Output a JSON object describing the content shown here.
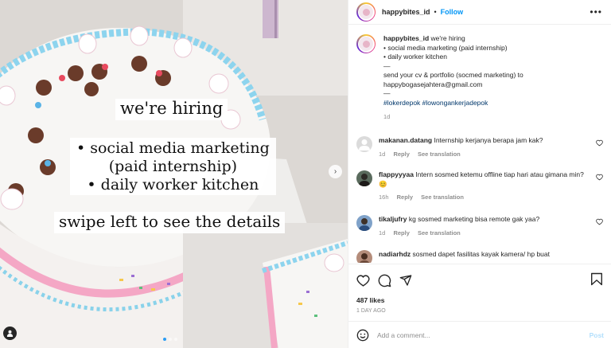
{
  "post": {
    "media_captions": {
      "line1": "we're hiring",
      "line2a": "• social media marketing",
      "line2b": "(paid internship)",
      "line2c": "• daily worker kitchen",
      "line3": "swipe left to see the details"
    },
    "carousel": {
      "total": 3,
      "active": 1
    }
  },
  "header": {
    "username": "happybites_id",
    "separator": "•",
    "follow_label": "Follow",
    "more_icon": "more-horizontal-icon"
  },
  "caption": {
    "username": "happybites_id",
    "first_line": "we're hiring",
    "lines": [
      "• social media marketing (paid internship)",
      "• daily worker kitchen",
      "—",
      "send your cv & portfolio (socmed marketing) to",
      "happybogasejahtera@gmail.com",
      "—"
    ],
    "tags": "#lokerdepok #lowongankerjadepok",
    "age": "1d"
  },
  "comments": [
    {
      "username": "makanan.datang",
      "text": "Internship kerjanya berapa jam kak?",
      "age": "1d",
      "reply": "Reply",
      "translate": "See translation"
    },
    {
      "username": "flappyyyaa",
      "text": "Intern sosmed ketemu offline tiap hari atau gimana min? 😊",
      "age": "16h",
      "reply": "Reply",
      "translate": "See translation"
    },
    {
      "username": "tikaljufry",
      "text": "kg sosmed marketing bisa remote gak yaa?",
      "age": "1d",
      "reply": "Reply",
      "translate": "See translation"
    },
    {
      "username": "nadiarhdz",
      "text": "sosmed dapet fasilitas kayak kamera/ hp buat",
      "age": "",
      "reply": "",
      "translate": ""
    }
  ],
  "actions": {
    "likes": "487 likes",
    "time": "1 day ago"
  },
  "add_comment": {
    "placeholder": "Add a comment...",
    "post_label": "Post"
  },
  "colors": {
    "accent": "#0095f6",
    "link": "#00376b",
    "muted": "#8e8e8e",
    "post_disabled": "#b2dffc"
  }
}
